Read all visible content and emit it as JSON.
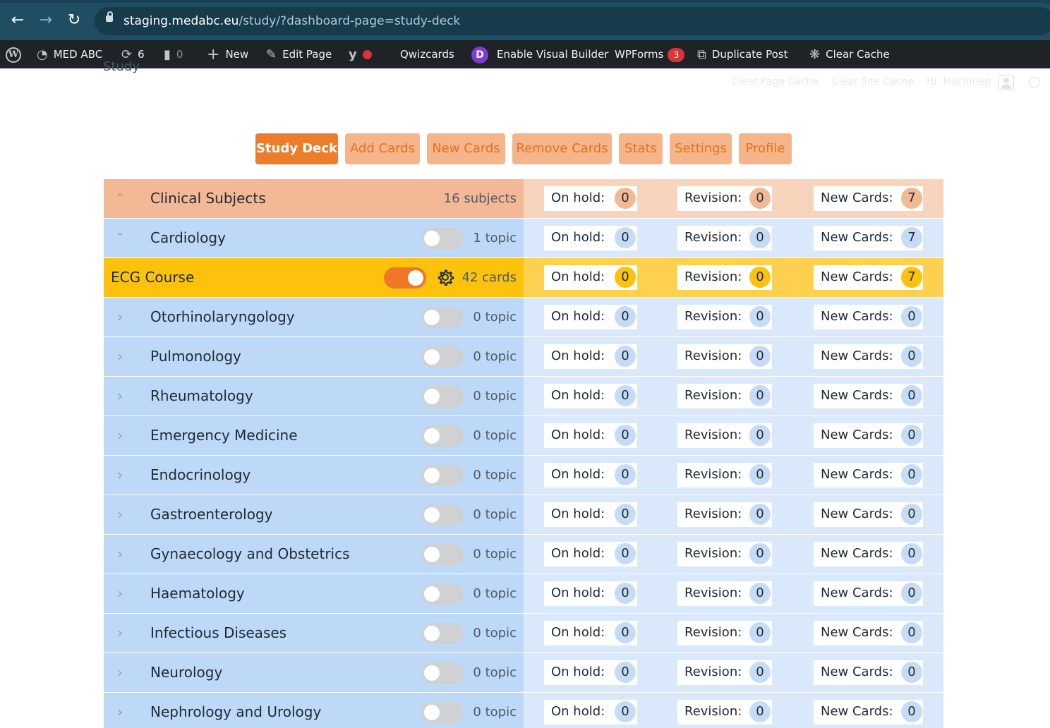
{
  "browser": {
    "url_host": "staging.medabc.eu",
    "url_path": "/study/?dashboard-page=study-deck"
  },
  "adminbar": {
    "site_name": "MED ABC",
    "updates_count": "6",
    "comments_count": "0",
    "new_label": "New",
    "edit_label": "Edit Page",
    "qwizcards_label": "Qwizcards",
    "visual_builder_label": "Enable Visual Builder",
    "wpforms_label": "WPForms",
    "wpforms_count": "3",
    "duplicate_label": "Duplicate Post",
    "clear_cache_label": "Clear Cache"
  },
  "underlay": {
    "page_title": "Study",
    "clear_page_cache": "Clear Page Cache",
    "clear_site_cache": "Clear Site Cache",
    "greeting": "Hi, Machinep"
  },
  "tabs": [
    {
      "label": "Study Deck",
      "active": true
    },
    {
      "label": "Add Cards"
    },
    {
      "label": "New Cards"
    },
    {
      "label": "Remove Cards"
    },
    {
      "label": "Stats"
    },
    {
      "label": "Settings"
    },
    {
      "label": "Profile"
    }
  ],
  "labels": {
    "on_hold": "On hold:",
    "revision": "Revision:",
    "new_cards": "New Cards:"
  },
  "deck": {
    "subject": {
      "name": "Clinical Subjects",
      "meta": "16 subjects",
      "on_hold": "0",
      "revision": "0",
      "new_cards": "7"
    },
    "topics": [
      {
        "name": "Cardiology",
        "meta": "1 topic",
        "on_hold": "0",
        "revision": "0",
        "new_cards": "7",
        "expanded": true
      },
      {
        "name": "ECG Course",
        "meta": "42 cards",
        "on_hold": "0",
        "revision": "0",
        "new_cards": "7",
        "is_deck": true,
        "enabled": true
      },
      {
        "name": "Otorhinolaryngology",
        "meta": "0 topic",
        "on_hold": "0",
        "revision": "0",
        "new_cards": "0"
      },
      {
        "name": "Pulmonology",
        "meta": "0 topic",
        "on_hold": "0",
        "revision": "0",
        "new_cards": "0"
      },
      {
        "name": "Rheumatology",
        "meta": "0 topic",
        "on_hold": "0",
        "revision": "0",
        "new_cards": "0"
      },
      {
        "name": "Emergency Medicine",
        "meta": "0 topic",
        "on_hold": "0",
        "revision": "0",
        "new_cards": "0"
      },
      {
        "name": "Endocrinology",
        "meta": "0 topic",
        "on_hold": "0",
        "revision": "0",
        "new_cards": "0"
      },
      {
        "name": "Gastroenterology",
        "meta": "0 topic",
        "on_hold": "0",
        "revision": "0",
        "new_cards": "0"
      },
      {
        "name": "Gynaecology and Obstetrics",
        "meta": "0 topic",
        "on_hold": "0",
        "revision": "0",
        "new_cards": "0"
      },
      {
        "name": "Haematology",
        "meta": "0 topic",
        "on_hold": "0",
        "revision": "0",
        "new_cards": "0"
      },
      {
        "name": "Infectious Diseases",
        "meta": "0 topic",
        "on_hold": "0",
        "revision": "0",
        "new_cards": "0"
      },
      {
        "name": "Neurology",
        "meta": "0 topic",
        "on_hold": "0",
        "revision": "0",
        "new_cards": "0"
      },
      {
        "name": "Nephrology and Urology",
        "meta": "0 topic",
        "on_hold": "0",
        "revision": "0",
        "new_cards": "0"
      }
    ]
  },
  "colors": {
    "accent": "#ec7d2c",
    "tab_inactive": "#f6b48a",
    "subject_row": "#f3b896",
    "topic_row": "#bed8f7",
    "deck_row": "#fcc20e"
  }
}
